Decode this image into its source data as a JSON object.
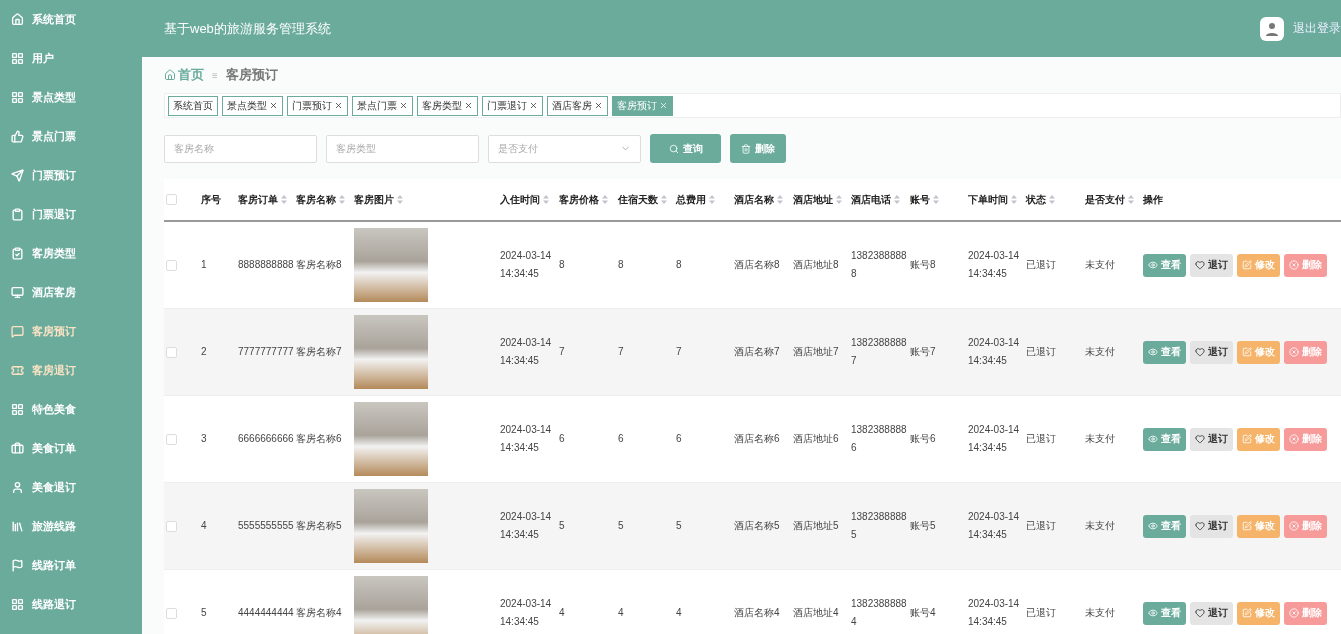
{
  "sidebar": {
    "items": [
      {
        "label": "系统首页",
        "highlighted": false
      },
      {
        "label": "用户",
        "highlighted": false
      },
      {
        "label": "景点类型",
        "highlighted": false
      },
      {
        "label": "景点门票",
        "highlighted": false
      },
      {
        "label": "门票预订",
        "highlighted": false
      },
      {
        "label": "门票退订",
        "highlighted": false
      },
      {
        "label": "客房类型",
        "highlighted": false
      },
      {
        "label": "酒店客房",
        "highlighted": false
      },
      {
        "label": "客房预订",
        "highlighted": true
      },
      {
        "label": "客房退订",
        "highlighted": true
      },
      {
        "label": "特色美食",
        "highlighted": false
      },
      {
        "label": "美食订单",
        "highlighted": false
      },
      {
        "label": "美食退订",
        "highlighted": false
      },
      {
        "label": "旅游线路",
        "highlighted": false
      },
      {
        "label": "线路订单",
        "highlighted": false
      },
      {
        "label": "线路退订",
        "highlighted": false
      }
    ]
  },
  "header": {
    "title": "基于web的旅游服务管理系统",
    "logout": "退出登录"
  },
  "breadcrumb": {
    "home": "首页",
    "separator": "≡",
    "current": "客房预订"
  },
  "tabs": [
    {
      "label": "系统首页",
      "closable": false,
      "selected": false
    },
    {
      "label": "景点类型",
      "closable": true,
      "selected": false
    },
    {
      "label": "门票预订",
      "closable": true,
      "selected": false
    },
    {
      "label": "景点门票",
      "closable": true,
      "selected": false
    },
    {
      "label": "客房类型",
      "closable": true,
      "selected": false
    },
    {
      "label": "门票退订",
      "closable": true,
      "selected": false
    },
    {
      "label": "酒店客房",
      "closable": true,
      "selected": false
    },
    {
      "label": "客房预订",
      "closable": true,
      "selected": true
    }
  ],
  "filters": {
    "fields": [
      {
        "kind": "text",
        "placeholder": "客房名称"
      },
      {
        "kind": "text",
        "placeholder": "客房类型"
      },
      {
        "kind": "select",
        "placeholder": "是否支付"
      }
    ],
    "buttons": [
      {
        "kind": "search",
        "label": "查询"
      },
      {
        "kind": "delete",
        "label": "删除"
      }
    ]
  },
  "table": {
    "all_checked": false,
    "columns": [
      {
        "label": "序号",
        "sortable": false
      },
      {
        "label": "客房订单",
        "sortable": true
      },
      {
        "label": "客房名称",
        "sortable": true
      },
      {
        "label": "客房图片",
        "sortable": true
      },
      {
        "label": "入住时间",
        "sortable": true
      },
      {
        "label": "客房价格",
        "sortable": true
      },
      {
        "label": "住宿天数",
        "sortable": true
      },
      {
        "label": "总费用",
        "sortable": true
      },
      {
        "label": "酒店名称",
        "sortable": true
      },
      {
        "label": "酒店地址",
        "sortable": true
      },
      {
        "label": "酒店电话",
        "sortable": true
      },
      {
        "label": "账号",
        "sortable": true
      },
      {
        "label": "下单时间",
        "sortable": true
      },
      {
        "label": "状态",
        "sortable": true
      },
      {
        "label": "是否支付",
        "sortable": true
      },
      {
        "label": "操作",
        "sortable": false
      }
    ],
    "rows": [
      {
        "checked": false,
        "cells": [
          "1",
          "8888888888",
          "客房名称8",
          "",
          "2024-03-14 14:34:45",
          "8",
          "8",
          "8",
          "酒店名称8",
          "酒店地址8",
          "13823888888",
          "账号8",
          "2024-03-14 14:34:45",
          "已退订",
          "未支付"
        ],
        "actions": [
          {
            "kind": "view",
            "label": "查看"
          },
          {
            "kind": "cancel",
            "label": "退订"
          },
          {
            "kind": "edit",
            "label": "修改"
          },
          {
            "kind": "delete",
            "label": "删除"
          }
        ]
      },
      {
        "checked": false,
        "cells": [
          "2",
          "7777777777",
          "客房名称7",
          "",
          "2024-03-14 14:34:45",
          "7",
          "7",
          "7",
          "酒店名称7",
          "酒店地址7",
          "13823888887",
          "账号7",
          "2024-03-14 14:34:45",
          "已退订",
          "未支付"
        ],
        "actions": [
          {
            "kind": "view",
            "label": "查看"
          },
          {
            "kind": "cancel",
            "label": "退订"
          },
          {
            "kind": "edit",
            "label": "修改"
          },
          {
            "kind": "delete",
            "label": "删除"
          }
        ]
      },
      {
        "checked": false,
        "cells": [
          "3",
          "6666666666",
          "客房名称6",
          "",
          "2024-03-14 14:34:45",
          "6",
          "6",
          "6",
          "酒店名称6",
          "酒店地址6",
          "13823888886",
          "账号6",
          "2024-03-14 14:34:45",
          "已退订",
          "未支付"
        ],
        "actions": [
          {
            "kind": "view",
            "label": "查看"
          },
          {
            "kind": "cancel",
            "label": "退订"
          },
          {
            "kind": "edit",
            "label": "修改"
          },
          {
            "kind": "delete",
            "label": "删除"
          }
        ]
      },
      {
        "checked": false,
        "cells": [
          "4",
          "5555555555",
          "客房名称5",
          "",
          "2024-03-14 14:34:45",
          "5",
          "5",
          "5",
          "酒店名称5",
          "酒店地址5",
          "13823888885",
          "账号5",
          "2024-03-14 14:34:45",
          "已退订",
          "未支付"
        ],
        "actions": [
          {
            "kind": "view",
            "label": "查看"
          },
          {
            "kind": "cancel",
            "label": "退订"
          },
          {
            "kind": "edit",
            "label": "修改"
          },
          {
            "kind": "delete",
            "label": "删除"
          }
        ]
      },
      {
        "checked": false,
        "cells": [
          "5",
          "4444444444",
          "客房名称4",
          "",
          "2024-03-14 14:34:45",
          "4",
          "4",
          "4",
          "酒店名称4",
          "酒店地址4",
          "13823888884",
          "账号4",
          "2024-03-14 14:34:45",
          "已退订",
          "未支付"
        ],
        "actions": [
          {
            "kind": "view",
            "label": "查看"
          },
          {
            "kind": "cancel",
            "label": "退订"
          },
          {
            "kind": "edit",
            "label": "修改"
          },
          {
            "kind": "delete",
            "label": "删除"
          }
        ]
      }
    ]
  }
}
